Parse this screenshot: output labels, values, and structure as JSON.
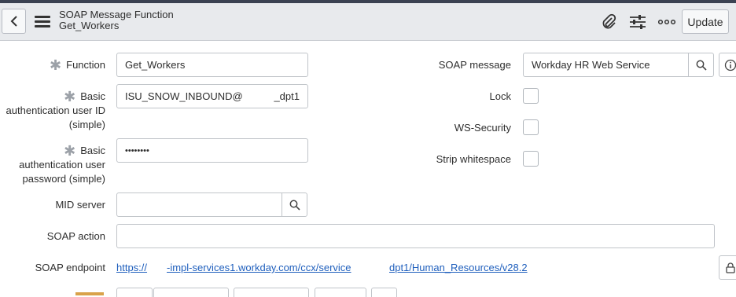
{
  "header": {
    "title": "SOAP Message Function",
    "subtitle": "Get_Workers",
    "update_label": "Update",
    "icons": [
      "back-icon",
      "menu-icon",
      "paperclip-icon",
      "sliders-icon",
      "more-icon"
    ]
  },
  "form": {
    "function_label": "Function",
    "function_value": "Get_Workers",
    "basic_user_label": "Basic authentication user ID (simple)",
    "basic_user_value_a": "ISU_SNOW_INBOUND@",
    "basic_user_value_b": "_dpt1",
    "basic_pass_label": "Basic authentication user password (simple)",
    "basic_pass_value": "••••••••",
    "mid_server_label": "MID server",
    "mid_server_value": "",
    "soap_action_label": "SOAP action",
    "soap_action_value": "",
    "soap_endpoint_label": "SOAP endpoint",
    "endpoint_part1": "https://",
    "endpoint_part2": "-impl-services1.workday.com/ccx/service",
    "endpoint_part3": "dpt1/Human_Resources/v28.2",
    "soap_message_label": "SOAP message",
    "soap_message_value": "Workday HR Web Service",
    "lock_label": "Lock",
    "ws_security_label": "WS-Security",
    "strip_whitespace_label": "Strip whitespace"
  },
  "colors": {
    "accent_link": "#1f5fbd",
    "header_bg": "#e8eaed",
    "top_bar": "#3b4252"
  }
}
